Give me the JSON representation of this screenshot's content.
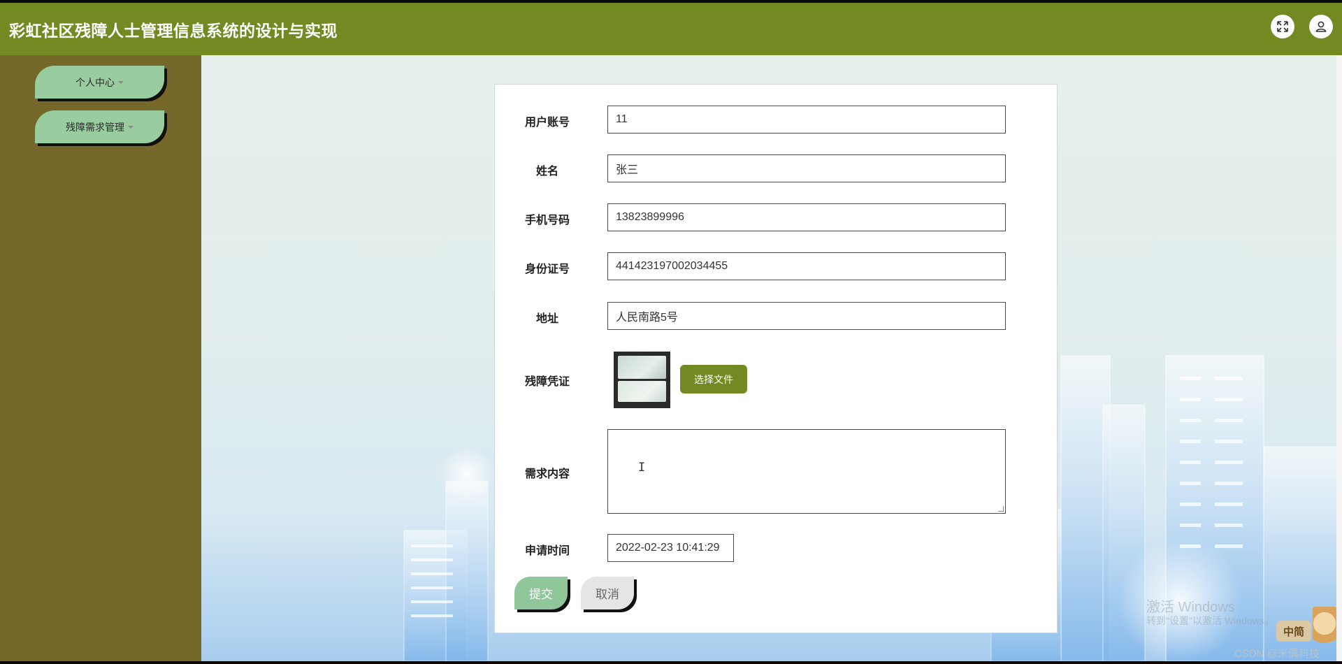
{
  "header": {
    "title": "彩虹社区残障人士管理信息系统的设计与实现"
  },
  "sidebar": {
    "items": [
      {
        "label": "个人中心"
      },
      {
        "label": "残障需求管理"
      }
    ]
  },
  "form": {
    "fields": [
      {
        "label": "用户账号",
        "value": "11"
      },
      {
        "label": "姓名",
        "value": "张三"
      },
      {
        "label": "手机号码",
        "value": "13823899996"
      },
      {
        "label": "身份证号",
        "value": "441423197002034455"
      },
      {
        "label": "地址",
        "value": "人民南路5号"
      }
    ],
    "proof": {
      "label": "残障凭证",
      "button": "选择文件"
    },
    "demand": {
      "label": "需求内容",
      "value": ""
    },
    "time": {
      "label": "申请时间",
      "value": "2022-02-23 10:41:29"
    },
    "submit": "提交",
    "cancel": "取消"
  },
  "watermark": {
    "line1": "激活 Windows",
    "line2": "转到\"设置\"以激活 Windows。",
    "badge": "中简",
    "credit": "CSDN @米偶科技"
  }
}
